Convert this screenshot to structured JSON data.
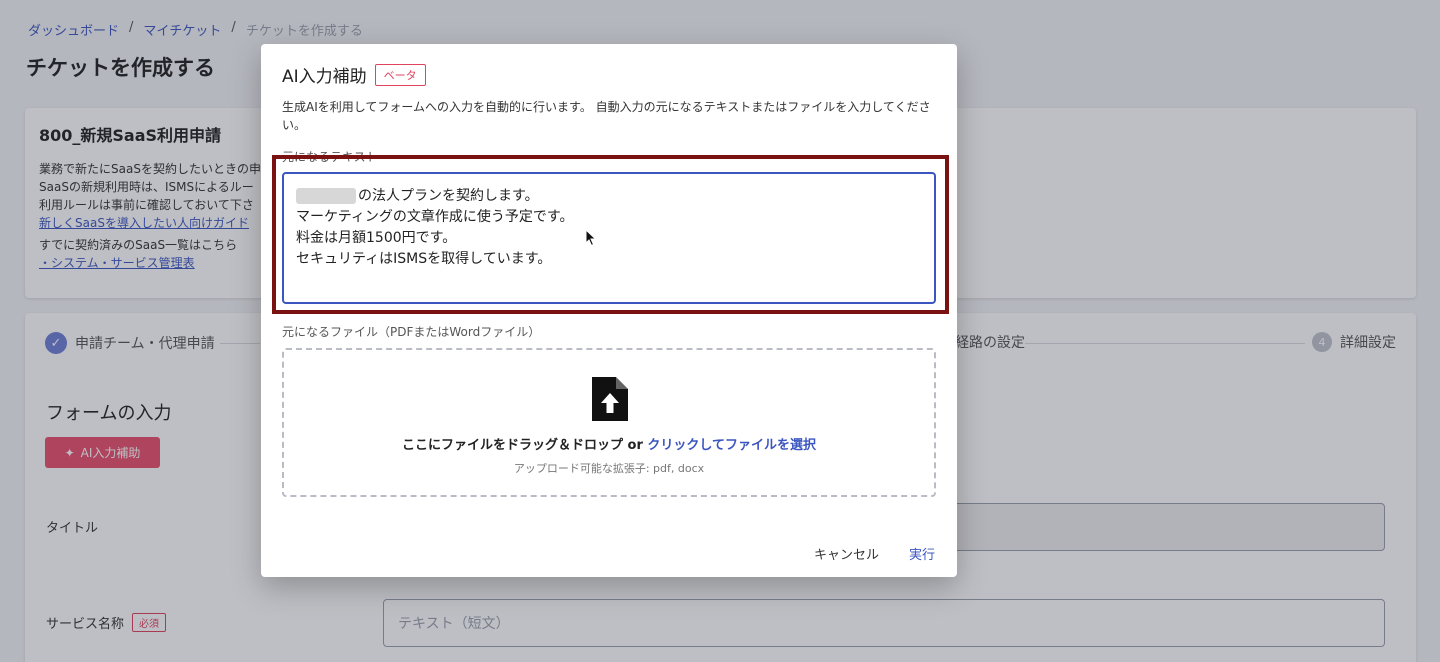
{
  "breadcrumb": {
    "items": [
      "ダッシュボード",
      "マイチケット"
    ],
    "current": "チケットを作成する",
    "separator": "/"
  },
  "page": {
    "title": "チケットを作成する"
  },
  "ticket_card": {
    "title": "800_新規SaaS利用申請",
    "desc_lines": [
      "業務で新たにSaaSを契約したいときの申",
      "SaaSの新規利用時は、ISMSによるルー",
      "利用ルールは事前に確認しておいて下さ"
    ],
    "guide_link": "新しくSaaSを導入したい人向けガイド",
    "list_text": "すでに契約済みのSaaS一覧はこちら",
    "list_link": "・システム・サービス管理表"
  },
  "steps": [
    {
      "label": "申請チーム・代理申請",
      "state": "done",
      "icon": "check-icon"
    },
    {
      "label": "経路の設定"
    },
    {
      "label": "詳細設定",
      "number": "4"
    }
  ],
  "form": {
    "heading": "フォームの入力",
    "ai_button": "AI入力補助",
    "title_label": "タイトル",
    "service_label": "サービス名称",
    "required_badge": "必須",
    "service_placeholder": "テキスト（短文）"
  },
  "modal": {
    "title": "AI入力補助",
    "badge": "ベータ",
    "description": "生成AIを利用してフォームへの入力を自動的に行います。 自動入力の元になるテキストまたはファイルを入力してください。",
    "text_label": "元になるテキスト",
    "text_lines": [
      "の法人プランを契約します。",
      "マーケティングの文章作成に使う予定です。",
      "料金は月額1500円です。",
      "セキュリティはISMSを取得しています。"
    ],
    "file_label": "元になるファイル（PDFまたはWordファイル）",
    "drop_text": "ここにファイルをドラッグ＆ドロップ or",
    "drop_link": "クリックしてファイルを選択",
    "drop_sub": "アップロード可能な拡張子: pdf, docx",
    "cancel": "キャンセル",
    "run": "実行"
  },
  "colors": {
    "accent": "#3b56c0",
    "danger": "#e0435e",
    "highlight_border": "#7a1212",
    "ai_button": "#e8506e"
  }
}
